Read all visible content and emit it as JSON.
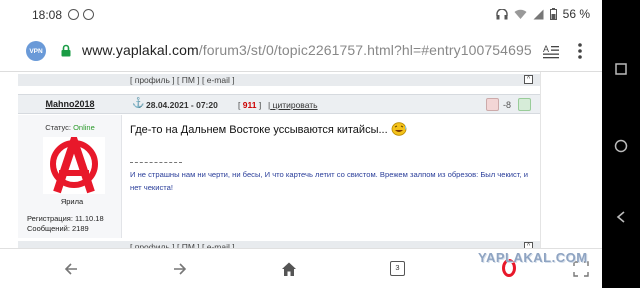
{
  "status_bar": {
    "time": "18:08",
    "battery": "56 %"
  },
  "address_bar": {
    "vpn_badge": "VPN",
    "url_host": "www.yaplakal.com",
    "url_path": "/forum3/st/0/topic2261757.html?hl=#entry100754695"
  },
  "post_bar": {
    "links": "[ профиль ] [ ПМ ] [ e-mail ]",
    "up_glyph": "^"
  },
  "post": {
    "username": "Mahno2018",
    "anchor_glyph": "⚓",
    "date": "28.04.2021 - 07:20",
    "number_open": "[",
    "number": "911",
    "number_close": "]",
    "quote_label": "цитировать",
    "quote_open": "|",
    "score": "-8",
    "message": "Где-то на Дальнем Востоке уссываются китайсы...",
    "signature": "И не страшны нам ни черти, ни бесы, И что картечь летит со свистом. Врежем залпом из обрезов: Был чекист, и нет чекиста!"
  },
  "profile": {
    "status_label": "Статус:",
    "status_value": "Online",
    "rank": "Ярила",
    "registration": "Регистрация: 11.10.18",
    "messages": "Сообщений: 2189"
  },
  "toolbar": {
    "tabs_count": "3"
  },
  "watermark": "YAPLAKAL.COM",
  "colors": {
    "accent_red": "#e8182a",
    "online_green": "#2a9a2a",
    "signature_blue": "#2a3e9a",
    "post_number_red": "#cc0000"
  }
}
